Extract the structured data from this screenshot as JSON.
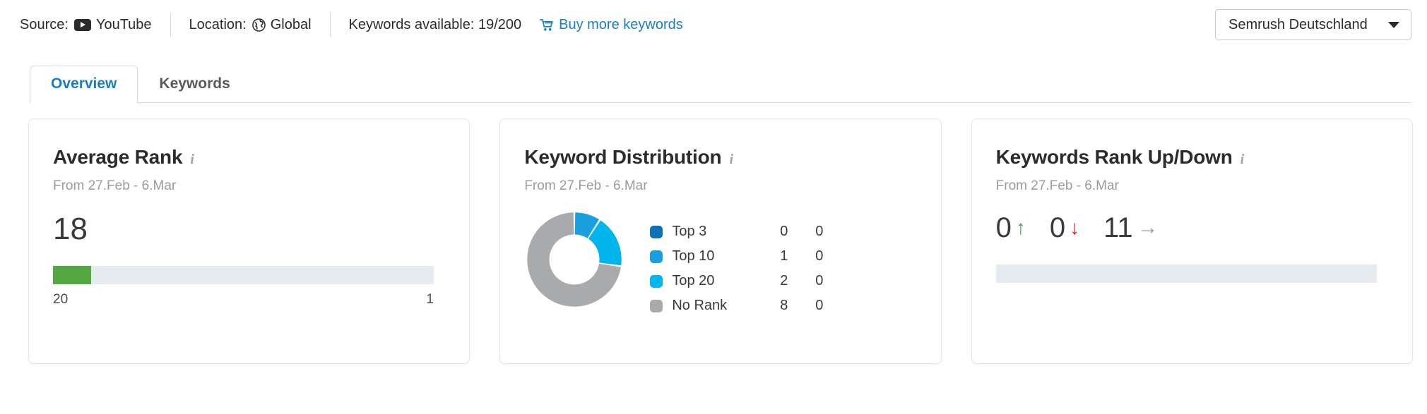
{
  "topbar": {
    "source_label": "Source:",
    "source_value": "YouTube",
    "source_icon": "youtube-icon",
    "location_label": "Location:",
    "location_value": "Global",
    "location_icon": "globe-icon",
    "keywords_available": "Keywords available: 19/200",
    "buy_link": "Buy more keywords",
    "buy_icon": "shopping-cart-icon",
    "account": "Semrush Deutschland",
    "account_chevron": "chevron-down-icon",
    "link_color": "#1a7fc1"
  },
  "tabs": [
    {
      "label": "Overview",
      "active": true
    },
    {
      "label": "Keywords",
      "active": false
    }
  ],
  "cards": {
    "average_rank": {
      "title": "Average Rank",
      "info_icon": "info-icon",
      "subtitle": "From 27.Feb - 6.Mar",
      "value": "18",
      "scale_min": "20",
      "scale_max": "1",
      "fill_percent": 10,
      "fill_color": "#54a844",
      "track_color": "#e6ebef"
    },
    "keyword_distribution": {
      "title": "Keyword Distribution",
      "info_icon": "info-icon",
      "subtitle": "From 27.Feb - 6.Mar",
      "legend": [
        {
          "label": "Top 3",
          "count": "0",
          "delta": "0",
          "color": "#0f71b5"
        },
        {
          "label": "Top 10",
          "count": "1",
          "delta": "0",
          "color": "#1a9fe0"
        },
        {
          "label": "Top 20",
          "count": "2",
          "delta": "0",
          "color": "#00b4ec"
        },
        {
          "label": "No Rank",
          "count": "8",
          "delta": "0",
          "color": "#a9aaac"
        }
      ]
    },
    "keywords_rank_up_down": {
      "title": "Keywords Rank Up/Down",
      "info_icon": "info-icon",
      "subtitle": "From 27.Feb - 6.Mar",
      "up_value": "0",
      "up_icon": "arrow-up-icon",
      "down_value": "0",
      "down_icon": "arrow-down-icon",
      "flat_value": "11",
      "flat_icon": "arrow-right-icon",
      "fill_percent": 0,
      "track_color": "#e6ebef"
    }
  },
  "chart_data": {
    "type": "pie",
    "title": "Keyword Distribution",
    "subtitle": "From 27.Feb - 6.Mar",
    "categories": [
      "Top 3",
      "Top 10",
      "Top 20",
      "No Rank"
    ],
    "values": [
      0,
      1,
      2,
      8
    ],
    "deltas": [
      0,
      0,
      0,
      0
    ],
    "colors": [
      "#0f71b5",
      "#1a9fe0",
      "#00b4ec",
      "#a9aaac"
    ],
    "total": 11,
    "legend_position": "right",
    "donut": true
  }
}
